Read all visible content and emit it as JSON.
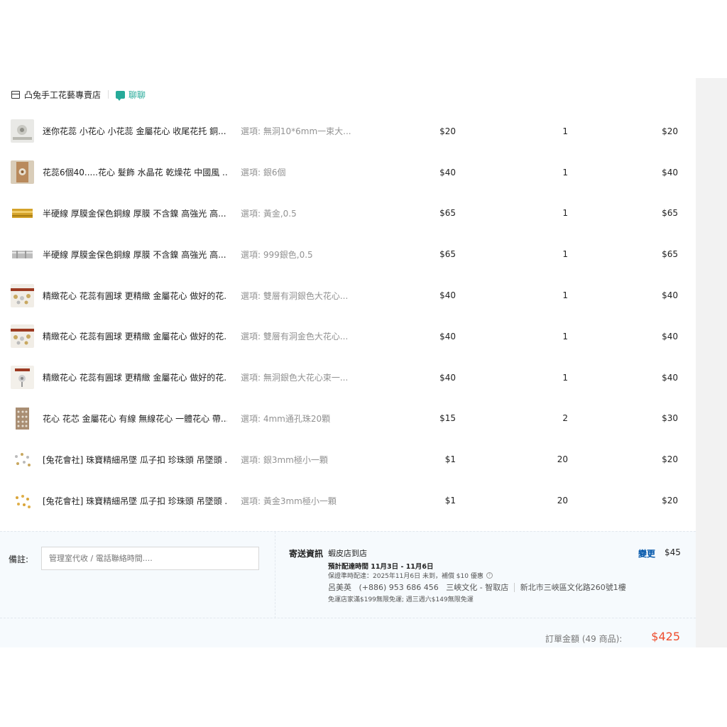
{
  "shop": {
    "name": "凸兔手工花藝專賣店",
    "chat_label": "聊聊"
  },
  "items": [
    {
      "name": "迷你花蕊 小花心 小花蕊 金屬花心 收尾花托 銅...",
      "variant": "選項: 無洞10*6mm一束大...",
      "price": "$20",
      "qty": "1",
      "subtotal": "$20",
      "thumb": "silver-flower"
    },
    {
      "name": "花蕊6個40.....花心 髮飾 水晶花 乾燥花 中國風 ...",
      "variant": "選項: 銀6個",
      "price": "$40",
      "qty": "1",
      "subtotal": "$40",
      "thumb": "bronze-flower"
    },
    {
      "name": "半硬線 厚膜金保色銅線 厚膜 不含鎳 高強光 高...",
      "variant": "選項: 黃金,0.5",
      "price": "$65",
      "qty": "1",
      "subtotal": "$65",
      "thumb": "gold-wire"
    },
    {
      "name": "半硬線 厚膜金保色銅線 厚膜 不含鎳 高強光 高...",
      "variant": "選項: 999銀色,0.5",
      "price": "$65",
      "qty": "1",
      "subtotal": "$65",
      "thumb": "silver-wire"
    },
    {
      "name": "精緻花心 花蕊有圓球 更精緻 金屬花心 做好的花...",
      "variant": "選項: 雙層有洞銀色大花心...",
      "price": "$40",
      "qty": "1",
      "subtotal": "$40",
      "thumb": "flower-set"
    },
    {
      "name": "精緻花心 花蕊有圓球 更精緻 金屬花心 做好的花...",
      "variant": "選項: 雙層有洞金色大花心...",
      "price": "$40",
      "qty": "1",
      "subtotal": "$40",
      "thumb": "flower-set"
    },
    {
      "name": "精緻花心 花蕊有圓球 更精緻 金屬花心 做好的花...",
      "variant": "選項: 無洞銀色大花心束一...",
      "price": "$40",
      "qty": "1",
      "subtotal": "$40",
      "thumb": "flower-box"
    },
    {
      "name": "花心 花芯 金屬花心 有線 無線花心 一體花心 帶...",
      "variant": "選項: 4mm通孔珠20顆",
      "price": "$15",
      "qty": "2",
      "subtotal": "$30",
      "thumb": "bead-card"
    },
    {
      "name": "[兔花會社] 珠寶精細吊墜 瓜子扣 珍珠頭 吊墜頭 ...",
      "variant": "選項: 銀3mm極小一顆",
      "price": "$1",
      "qty": "20",
      "subtotal": "$20",
      "thumb": "pendant-silver"
    },
    {
      "name": "[兔花會社] 珠寶精細吊墜 瓜子扣 珍珠頭 吊墜頭 ...",
      "variant": "選項: 黃金3mm極小一顆",
      "price": "$1",
      "qty": "20",
      "subtotal": "$20",
      "thumb": "pendant-gold"
    }
  ],
  "note": {
    "label": "備註:",
    "placeholder": "管理室代收 / 電話聯絡時間...."
  },
  "shipping": {
    "title": "寄送資訊",
    "method": "蝦皮店到店",
    "eta": "預計配達時間 11月3日 - 11月6日",
    "guarantee": "保證準時配達：2025年11月6日 未到，補償 $10 優惠",
    "recipient_name": "呂美英",
    "phone": "(+886) 953 686 456",
    "store": "三峽文化 - 智取店",
    "address": "新北市三峽區文化路260號1樓",
    "promo": "免運店家滿$199無限免運; 週三週六$149無限免運",
    "change_label": "變更",
    "fee": "$45"
  },
  "total": {
    "label": "訂單金額 (49 商品):",
    "value": "$425"
  },
  "colors": {
    "accent_teal": "#26aa99",
    "price_orange": "#ee4d2d",
    "link_blue": "#0055aa"
  }
}
